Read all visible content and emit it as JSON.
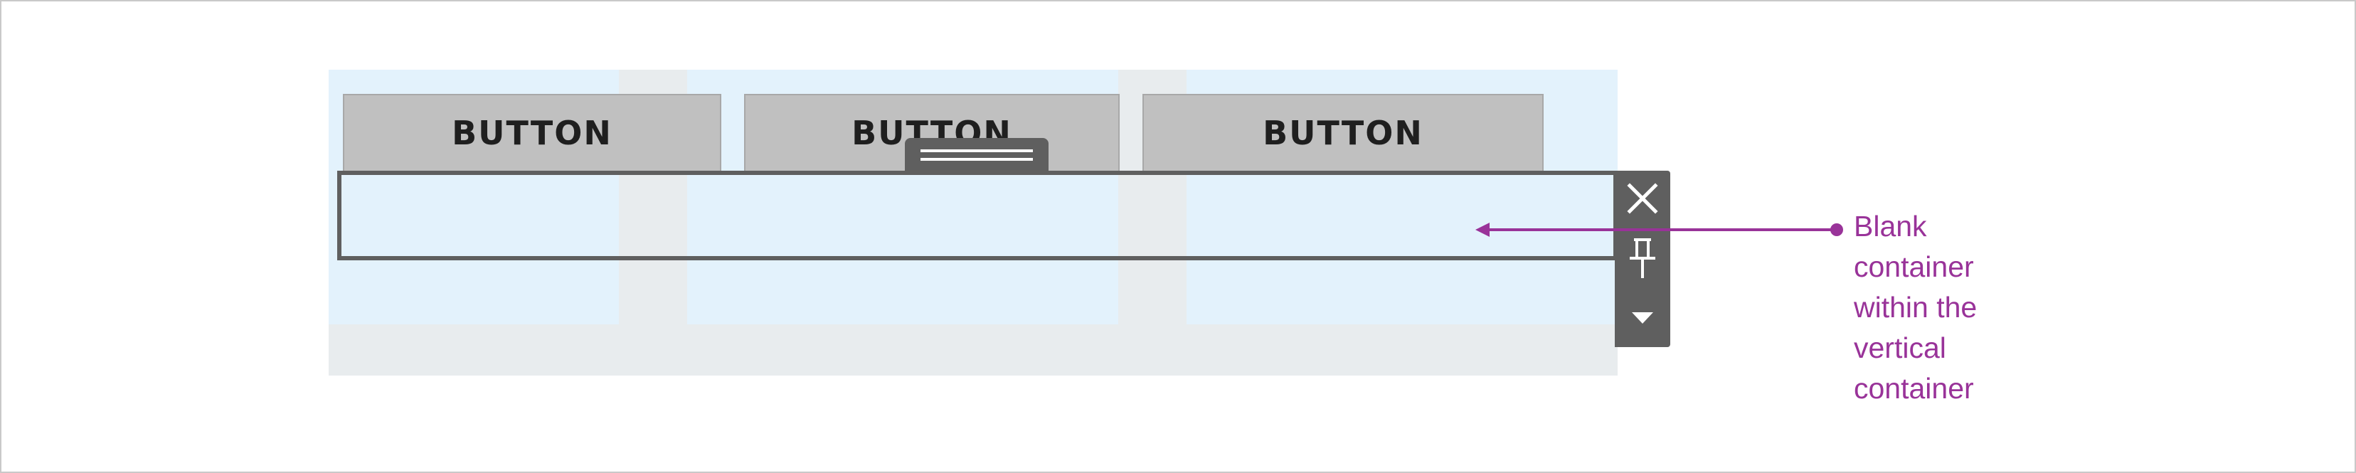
{
  "buttons": [
    {
      "label": "BUTTON"
    },
    {
      "label": "BUTTON"
    },
    {
      "label": "BUTTON"
    }
  ],
  "toolbar": {
    "close_icon": "close-icon",
    "pin_icon": "pin-icon",
    "menu_icon": "caret-down-icon"
  },
  "annotation": {
    "lines": [
      "Blank",
      "container",
      "within the",
      "vertical",
      "container"
    ]
  },
  "colors": {
    "column_fill": "#e3f2fc",
    "layout_fill": "#e8ecee",
    "button_fill": "#c0c0c0",
    "selection_border": "#5f5f5f",
    "annotation": "#993399"
  }
}
